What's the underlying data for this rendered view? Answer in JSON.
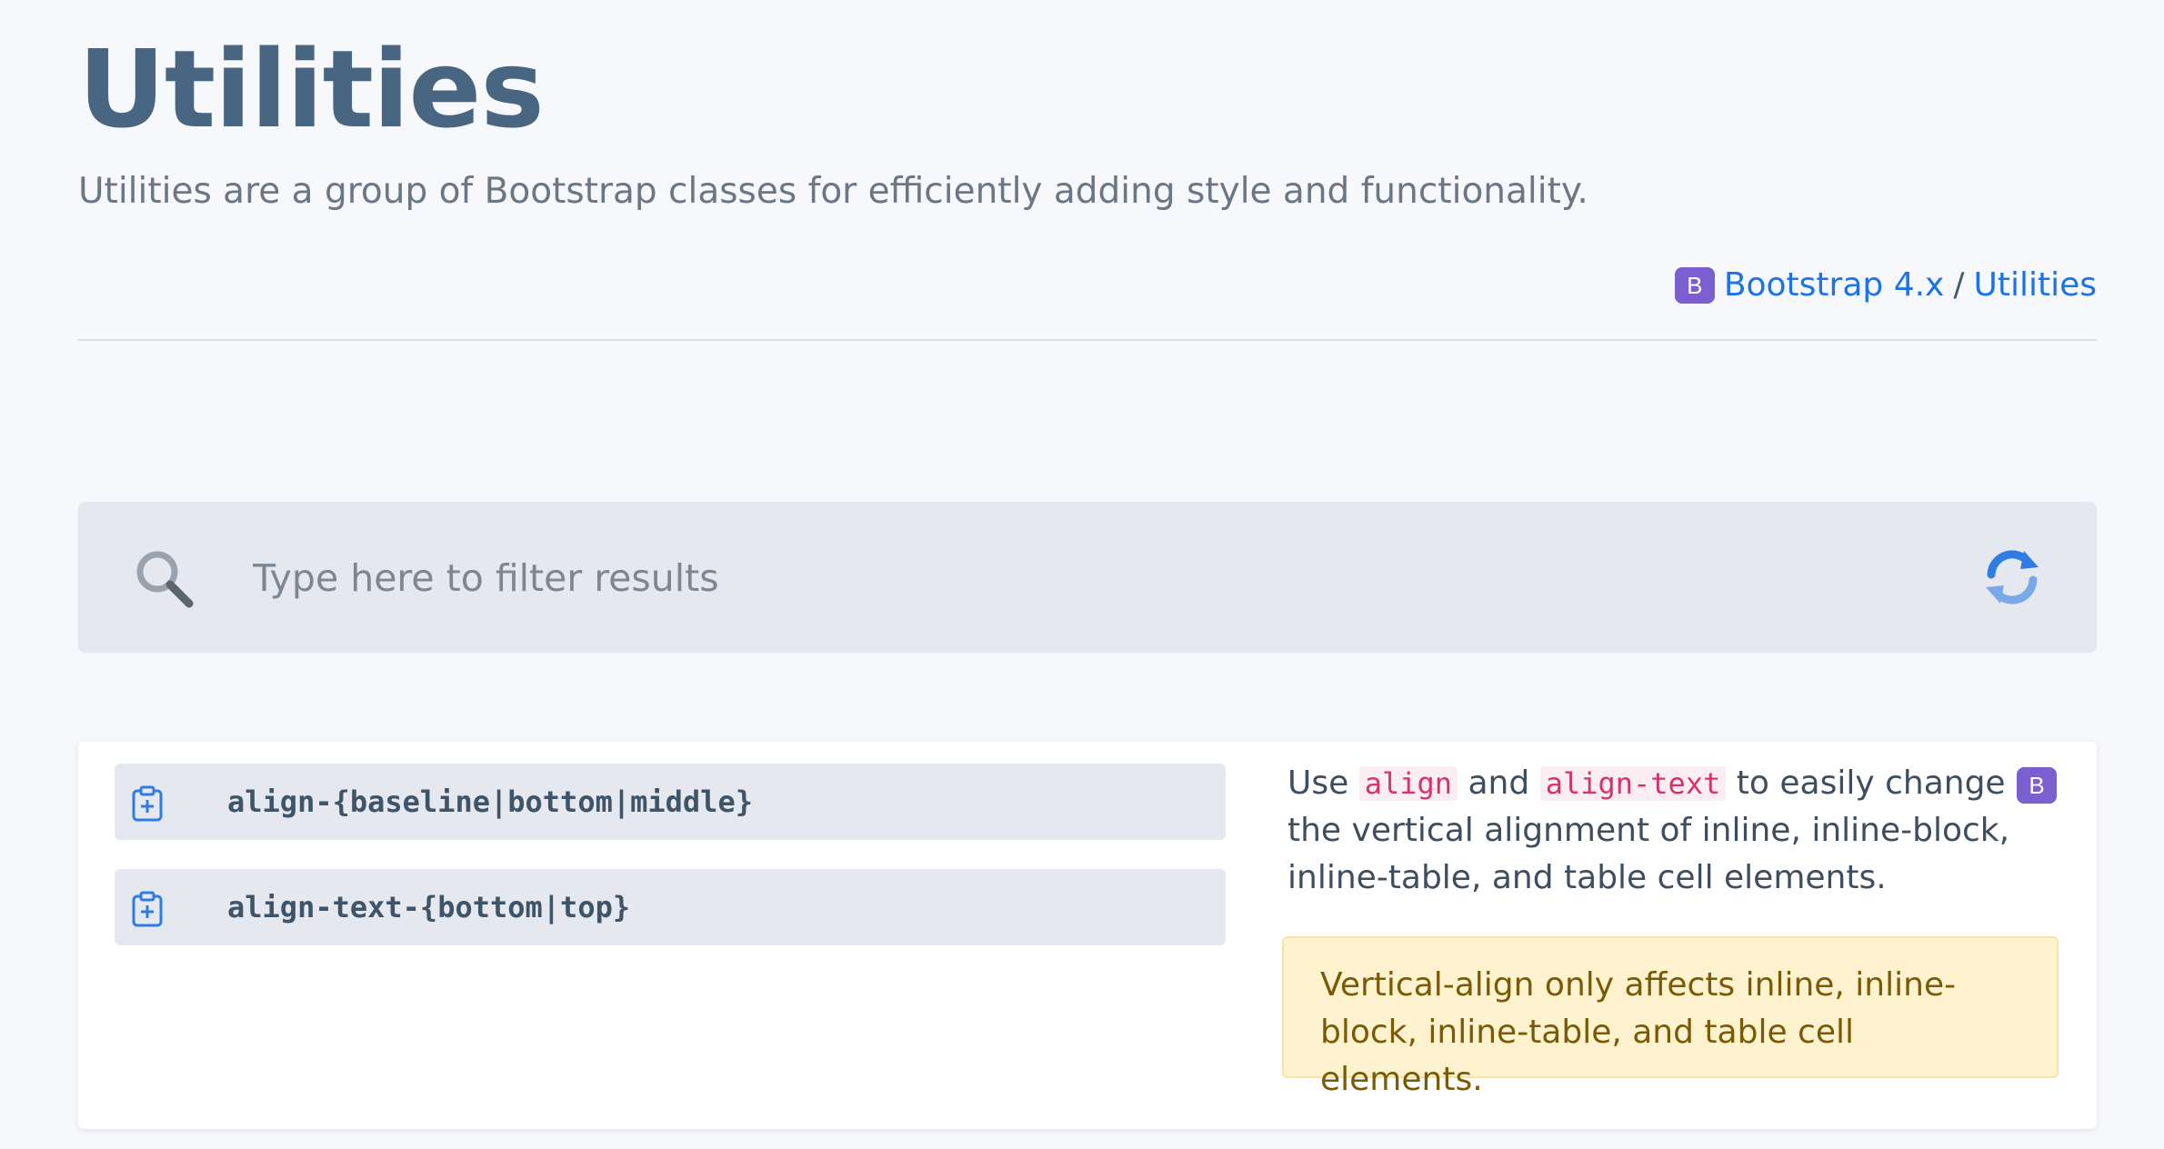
{
  "header": {
    "title": "Utilities",
    "subtitle": "Utilities are a group of Bootstrap classes for efficiently adding style and functionality."
  },
  "breadcrumb": {
    "icon": "bootstrap-icon",
    "icon_letter": "B",
    "items": [
      {
        "label": "Bootstrap 4.x"
      },
      {
        "label": "Utilities"
      }
    ],
    "separator": "/"
  },
  "search": {
    "placeholder": "Type here to filter results",
    "value": "",
    "search_icon": "search-icon",
    "refresh_icon": "refresh-icon"
  },
  "results": [
    {
      "classes": [
        {
          "code": "align-{baseline|bottom|middle}",
          "icon": "clipboard-plus-icon"
        },
        {
          "code": "align-text-{bottom|top}",
          "icon": "clipboard-plus-icon"
        }
      ],
      "description": {
        "prefix": "Use",
        "code1": "align",
        "middle": "and",
        "code2": "align-text",
        "suffix": "to easily change the vertical alignment of inline, inline-block, inline-table, and table cell elements."
      },
      "badge_letter": "B",
      "warning": "Vertical-align only affects inline, inline-block, inline-table, and table cell elements."
    }
  ],
  "colors": {
    "accent": "#1b73e8",
    "bootstrap_purple": "#7b5fd1",
    "title": "#486581",
    "code_pink": "#d6336c",
    "warning_bg": "#fff3cf",
    "warning_text": "#7a5a06"
  }
}
